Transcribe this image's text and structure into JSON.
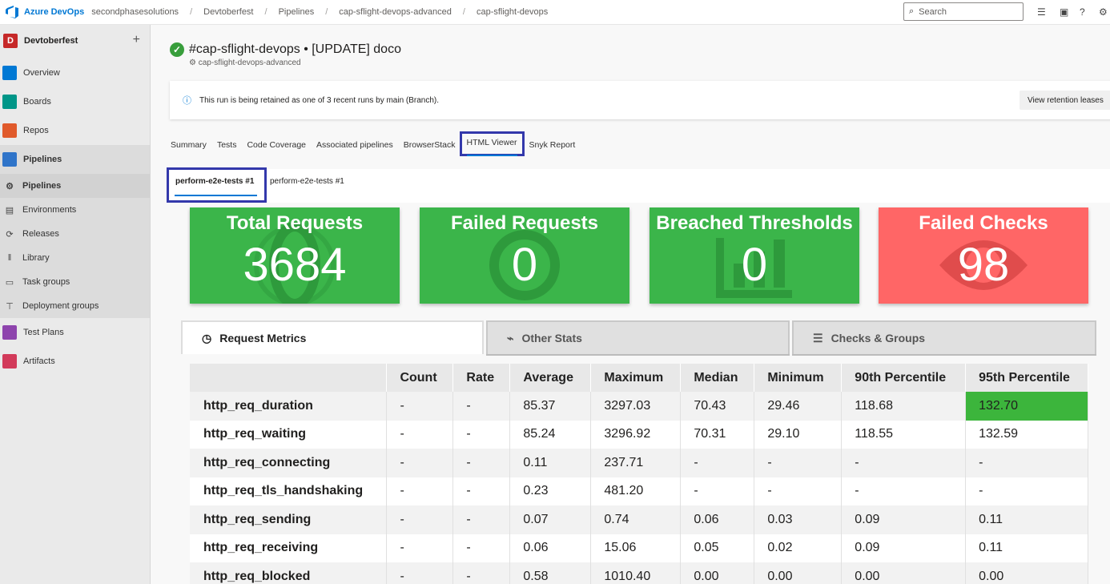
{
  "topbar": {
    "brand": "Azure DevOps",
    "breadcrumbs": [
      "secondphasesolutions",
      "Devtoberfest",
      "Pipelines",
      "cap-sflight-devops-advanced",
      "cap-sflight-devops"
    ],
    "search_placeholder": "Search"
  },
  "sidebar": {
    "project_initial": "D",
    "project_name": "Devtoberfest",
    "items": [
      {
        "label": "Overview"
      },
      {
        "label": "Boards"
      },
      {
        "label": "Repos"
      },
      {
        "label": "Pipelines"
      }
    ],
    "pipeline_subitems": [
      {
        "label": "Pipelines"
      },
      {
        "label": "Environments"
      },
      {
        "label": "Releases"
      },
      {
        "label": "Library"
      },
      {
        "label": "Task groups"
      },
      {
        "label": "Deployment groups"
      }
    ],
    "bottom_items": [
      {
        "label": "Test Plans"
      },
      {
        "label": "Artifacts"
      }
    ]
  },
  "run": {
    "title": "#cap-sflight-devops • [UPDATE] doco",
    "subtitle": "cap-sflight-devops-advanced",
    "banner_text": "This run is being retained as one of 3 recent runs by main (Branch).",
    "retention_button": "View retention leases"
  },
  "tabs": [
    "Summary",
    "Tests",
    "Code Coverage",
    "Associated pipelines",
    "BrowserStack",
    "HTML Viewer",
    "Snyk Report"
  ],
  "active_tab": "HTML Viewer",
  "subtabs": [
    "perform-e2e-tests #1",
    "perform-e2e-tests #1"
  ],
  "cards": [
    {
      "title": "Total Requests",
      "value": "3684",
      "color": "#3bb54a"
    },
    {
      "title": "Failed Requests",
      "value": "0",
      "color": "#3bb54a"
    },
    {
      "title": "Breached Thresholds",
      "value": "0",
      "color": "#3bb54a"
    },
    {
      "title": "Failed Checks",
      "value": "98",
      "color": "#ff6666"
    }
  ],
  "metric_tabs": [
    {
      "label": "Request Metrics",
      "icon": "clock-icon"
    },
    {
      "label": "Other Stats",
      "icon": "chart-icon"
    },
    {
      "label": "Checks & Groups",
      "icon": "list-check-icon"
    }
  ],
  "table": {
    "headers": [
      "",
      "Count",
      "Rate",
      "Average",
      "Maximum",
      "Median",
      "Minimum",
      "90th Percentile",
      "95th Percentile"
    ],
    "rows": [
      [
        "http_req_duration",
        "-",
        "-",
        "85.37",
        "3297.03",
        "70.43",
        "29.46",
        "118.68",
        "132.70"
      ],
      [
        "http_req_waiting",
        "-",
        "-",
        "85.24",
        "3296.92",
        "70.31",
        "29.10",
        "118.55",
        "132.59"
      ],
      [
        "http_req_connecting",
        "-",
        "-",
        "0.11",
        "237.71",
        "-",
        "-",
        "-",
        "-"
      ],
      [
        "http_req_tls_handshaking",
        "-",
        "-",
        "0.23",
        "481.20",
        "-",
        "-",
        "-",
        "-"
      ],
      [
        "http_req_sending",
        "-",
        "-",
        "0.07",
        "0.74",
        "0.06",
        "0.03",
        "0.09",
        "0.11"
      ],
      [
        "http_req_receiving",
        "-",
        "-",
        "0.06",
        "15.06",
        "0.05",
        "0.02",
        "0.09",
        "0.11"
      ],
      [
        "http_req_blocked",
        "-",
        "-",
        "0.58",
        "1010.40",
        "0.00",
        "0.00",
        "0.00",
        "0.00"
      ]
    ],
    "highlight_color": "#3cb53c"
  }
}
